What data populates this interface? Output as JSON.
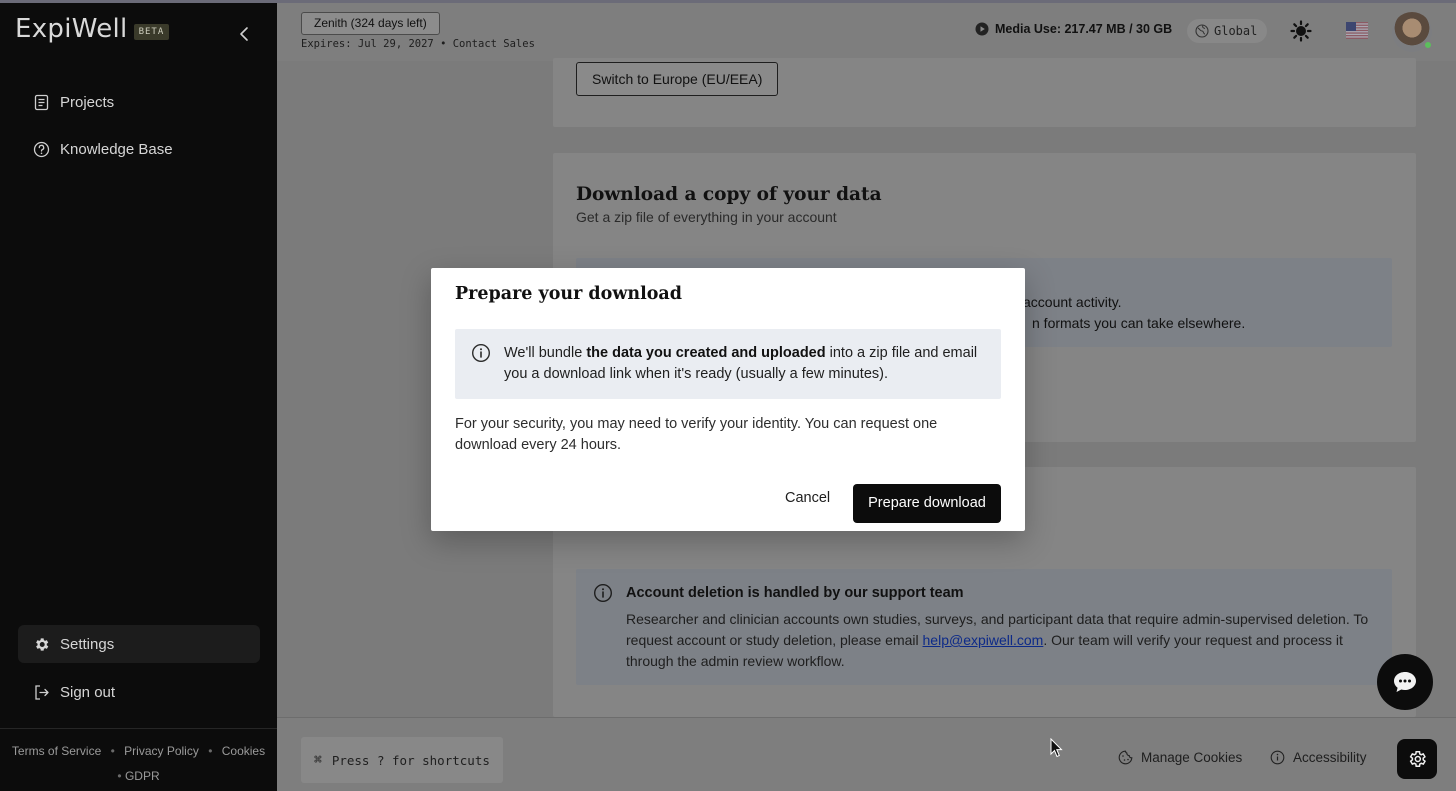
{
  "sidebar": {
    "logo": "ExpiWell",
    "beta": "BETA",
    "nav": [
      {
        "label": "Projects"
      },
      {
        "label": "Knowledge Base"
      }
    ],
    "settings": "Settings",
    "signout": "Sign out",
    "footer": {
      "terms": "Terms of Service",
      "privacy": "Privacy Policy",
      "cookies": "Cookies",
      "gdpr": "GDPR",
      "sep": "•"
    }
  },
  "topbar": {
    "plan": "Zenith (324 days left)",
    "expires": "Expires: Jul 29, 2027 • Contact Sales",
    "media": "Media Use: 217.47 MB / 30 GB",
    "region": "Global"
  },
  "content": {
    "switch_region": "Switch to Europe (EU/EEA)",
    "download_title": "Download a copy of your data",
    "download_sub": "Get a zip file of everything in your account",
    "bg_line1": "account activity.",
    "bg_line2": "n formats you can take elsewhere.",
    "deletion_title": "Account deletion is handled by our support team",
    "deletion_body_1": "Researcher and clinician accounts own studies, surveys, and participant data that require admin-supervised deletion. To request account or study deletion, please email ",
    "deletion_email": "help@expiwell.com",
    "deletion_body_2": ". Our team will verify your request and process it through the admin review workflow."
  },
  "modal": {
    "title": "Prepare your download",
    "notice_pre": "We'll bundle ",
    "notice_bold": "the data you created and uploaded",
    "notice_post": " into a zip file and email you a download link when it's ready (usually a few minutes).",
    "security": "For your security, you may need to verify your identity. You can request one download every 24 hours.",
    "cancel": "Cancel",
    "confirm": "Prepare download"
  },
  "bottombar": {
    "shortcut_key": "⌘",
    "shortcuts": "Press ? for shortcuts",
    "manage_cookies": "Manage Cookies",
    "accessibility": "Accessibility"
  },
  "colors": {
    "sidebar_bg": "#0c0c0c",
    "overlay": "#7b7b7b",
    "primary_button": "#0c0c0c",
    "link": "#0d2a88",
    "online": "#5cbf5c"
  }
}
